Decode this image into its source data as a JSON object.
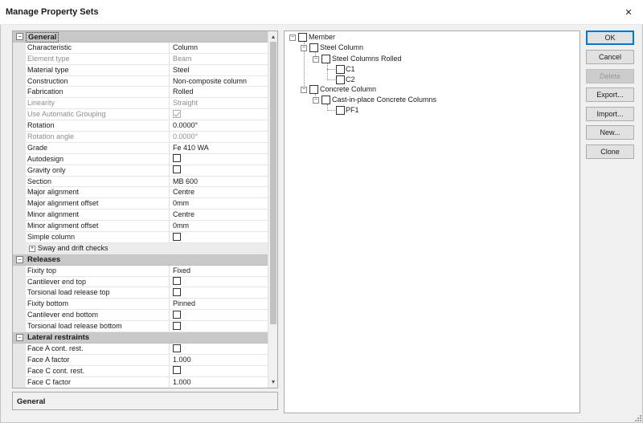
{
  "window": {
    "title": "Manage Property Sets",
    "close_glyph": "✕"
  },
  "property_grid": {
    "categories": {
      "general": "General",
      "releases": "Releases",
      "lateral": "Lateral restraints"
    },
    "general_rows": [
      {
        "name": "Characteristic",
        "value": "Column"
      },
      {
        "name": "Element type",
        "value": "Beam"
      },
      {
        "name": "Material type",
        "value": "Steel"
      },
      {
        "name": "Construction",
        "value": "Non-composite column"
      },
      {
        "name": "Fabrication",
        "value": "Rolled"
      },
      {
        "name": "Linearity",
        "value": "Straight"
      },
      {
        "name": "Use Automatic Grouping",
        "value": ""
      },
      {
        "name": "Rotation",
        "value": "0.0000°"
      },
      {
        "name": "Rotation angle",
        "value": "0.0000°"
      },
      {
        "name": "Grade",
        "value": "Fe 410 WA"
      },
      {
        "name": "Autodesign",
        "value": ""
      },
      {
        "name": "Gravity only",
        "value": ""
      },
      {
        "name": "Section",
        "value": "MB 600"
      },
      {
        "name": "Major alignment",
        "value": "Centre"
      },
      {
        "name": "Major alignment offset",
        "value": "0mm"
      },
      {
        "name": "Minor alignment",
        "value": "Centre"
      },
      {
        "name": "Minor alignment offset",
        "value": "0mm"
      },
      {
        "name": "Simple column",
        "value": ""
      }
    ],
    "subgroup": {
      "name": "Sway and drift checks"
    },
    "release_rows": [
      {
        "name": "Fixity top",
        "value": "Fixed"
      },
      {
        "name": "Cantilever end top",
        "value": ""
      },
      {
        "name": "Torsional load release top",
        "value": ""
      },
      {
        "name": "Fixity bottom",
        "value": "Pinned"
      },
      {
        "name": "Cantilever end bottom",
        "value": ""
      },
      {
        "name": "Torsional load release bottom",
        "value": ""
      }
    ],
    "lateral_rows": [
      {
        "name": "Face A cont. rest.",
        "value": ""
      },
      {
        "name": "Face A factor",
        "value": "1.000"
      },
      {
        "name": "Face C cont. rest.",
        "value": ""
      },
      {
        "name": "Face C factor",
        "value": "1.000"
      }
    ]
  },
  "description": {
    "title": "General"
  },
  "tree": {
    "nodes": [
      {
        "label": "Member"
      },
      {
        "label": "Steel Column"
      },
      {
        "label": "Steel Columns Rolled"
      },
      {
        "label": "C1"
      },
      {
        "label": "C2"
      },
      {
        "label": "Concrete Column"
      },
      {
        "label": "Cast-in-place Concrete Columns"
      },
      {
        "label": "PF1"
      }
    ]
  },
  "buttons": {
    "ok": "OK",
    "cancel": "Cancel",
    "delete": "Delete",
    "export": "Export...",
    "import": "Import...",
    "new": "New...",
    "clone": "Clone"
  },
  "colors": {
    "accent": "#0078d7",
    "category_band": "#c8c8c8"
  }
}
